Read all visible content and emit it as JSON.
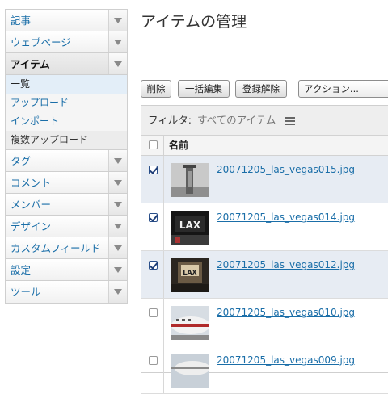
{
  "sidebar": {
    "items": [
      {
        "label": "記事"
      },
      {
        "label": "ウェブページ"
      },
      {
        "label": "アイテム"
      },
      {
        "label": "タグ"
      },
      {
        "label": "コメント"
      },
      {
        "label": "メンバー"
      },
      {
        "label": "デザイン"
      },
      {
        "label": "カスタムフィールド"
      },
      {
        "label": "設定"
      },
      {
        "label": "ツール"
      }
    ],
    "sub_items": [
      {
        "label": "一覧"
      },
      {
        "label": "アップロード"
      },
      {
        "label": "インポート"
      },
      {
        "label": "複数アップロード"
      }
    ]
  },
  "page": {
    "title": "アイテムの管理"
  },
  "toolbar": {
    "delete_label": "削除",
    "bulk_edit_label": "一括編集",
    "unregister_label": "登録解除",
    "action_select": "アクション..."
  },
  "filter": {
    "label": "フィルタ:",
    "value": "すべてのアイテム"
  },
  "list": {
    "header_name": "名前",
    "rows": [
      {
        "filename": "20071205_las_vegas015.jpg",
        "checked": true
      },
      {
        "filename": "20071205_las_vegas014.jpg",
        "checked": true
      },
      {
        "filename": "20071205_las_vegas012.jpg",
        "checked": true
      },
      {
        "filename": "20071205_las_vegas010.jpg",
        "checked": false
      },
      {
        "filename": "20071205_las_vegas009.jpg",
        "checked": false
      }
    ]
  },
  "thumb_texts": {
    "lax": "LAX"
  },
  "colors": {
    "link": "#1a6ea8",
    "selected_row": "#e7ecf3",
    "current_sub": "#e3eef8"
  }
}
